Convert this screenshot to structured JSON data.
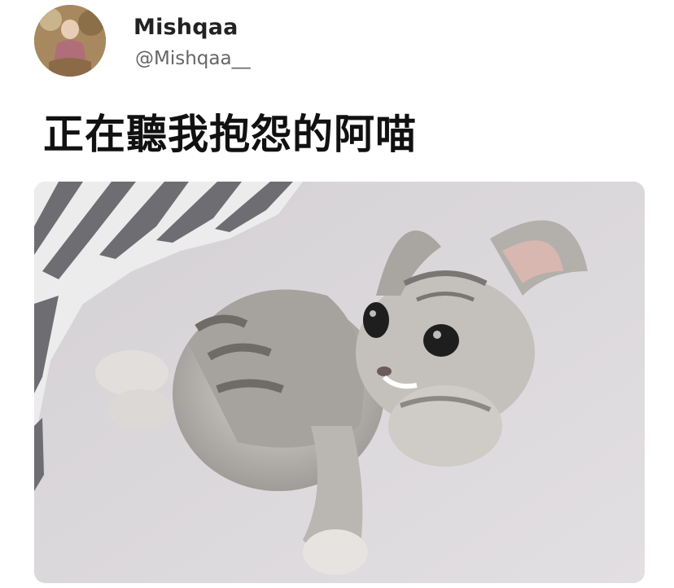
{
  "user": {
    "display_name": "Mishqaa",
    "handle": "@Mishqaa__",
    "avatar_icon": "profile-photo"
  },
  "tweet": {
    "text": "正在聽我抱怨的阿喵"
  },
  "media": {
    "icon": "kitten-photo",
    "colors": {
      "sheet": "#d7d4d7",
      "stripe_dark": "#6e6d72",
      "fur_light": "#c9c6c4",
      "fur_dark": "#7d7a78"
    }
  }
}
